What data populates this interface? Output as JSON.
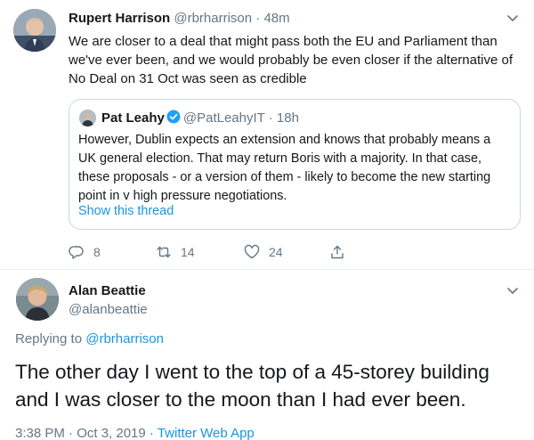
{
  "tweet": {
    "author_name": "Rupert Harrison",
    "author_handle": "@rbrharrison",
    "separator": "·",
    "age": "48m",
    "text": "We are closer to a deal that might pass both the EU and Parliament than we've ever been, and we would probably be even closer if the alternative of No Deal on 31 Oct was seen as credible",
    "quoted": {
      "author_name": "Pat Leahy",
      "author_handle": "@PatLeahyIT",
      "separator": "·",
      "age": "18h",
      "text": "However, Dublin expects an extension and knows that probably means a UK general election. That may return Boris with a majority. In that case, these proposals - or a version of them - likely to become the new starting point in v high pressure negotiations.",
      "show_thread": "Show this thread"
    },
    "actions": {
      "reply_count": "8",
      "retweet_count": "14",
      "like_count": "24"
    }
  },
  "reply": {
    "author_name": "Alan Beattie",
    "author_handle": "@alanbeattie",
    "replying_prefix": "Replying to",
    "replying_to": "@rbrharrison",
    "text": "The other day I went to the top of a 45-storey building and I was closer to the moon than I had ever been.",
    "time": "3:38 PM · Oct 3, 2019 · ",
    "source": "Twitter Web App"
  },
  "icons": {
    "caret": "chevron-down-icon",
    "verified": "verified-badge-icon",
    "reply": "reply-icon",
    "retweet": "retweet-icon",
    "like": "heart-icon",
    "share": "share-icon"
  },
  "colors": {
    "link": "#1b95e0",
    "muted": "#657786",
    "text": "#14171a",
    "border": "#ccd6dd",
    "verified": "#1da1f2"
  }
}
